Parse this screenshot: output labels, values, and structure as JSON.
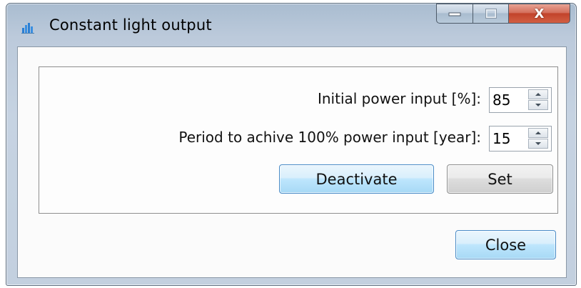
{
  "window": {
    "title": "Constant light output",
    "app_icon": "bar-chart-icon",
    "caption_buttons": {
      "minimize_icon": "minimize-icon",
      "maximize_icon": "maximize-icon",
      "close_icon": "close-icon",
      "close_glyph": "X"
    }
  },
  "settings": {
    "initial_power": {
      "label": "Initial power input [%]:",
      "value": "85"
    },
    "period": {
      "label": "Period to achive 100% power input [year]:",
      "value": "15"
    },
    "deactivate_label": "Deactivate",
    "set_label": "Set"
  },
  "footer": {
    "close_label": "Close"
  },
  "colors": {
    "titlebar": "#bccadb",
    "close_button": "#c2432b",
    "accent_button": "#bee6fd"
  }
}
